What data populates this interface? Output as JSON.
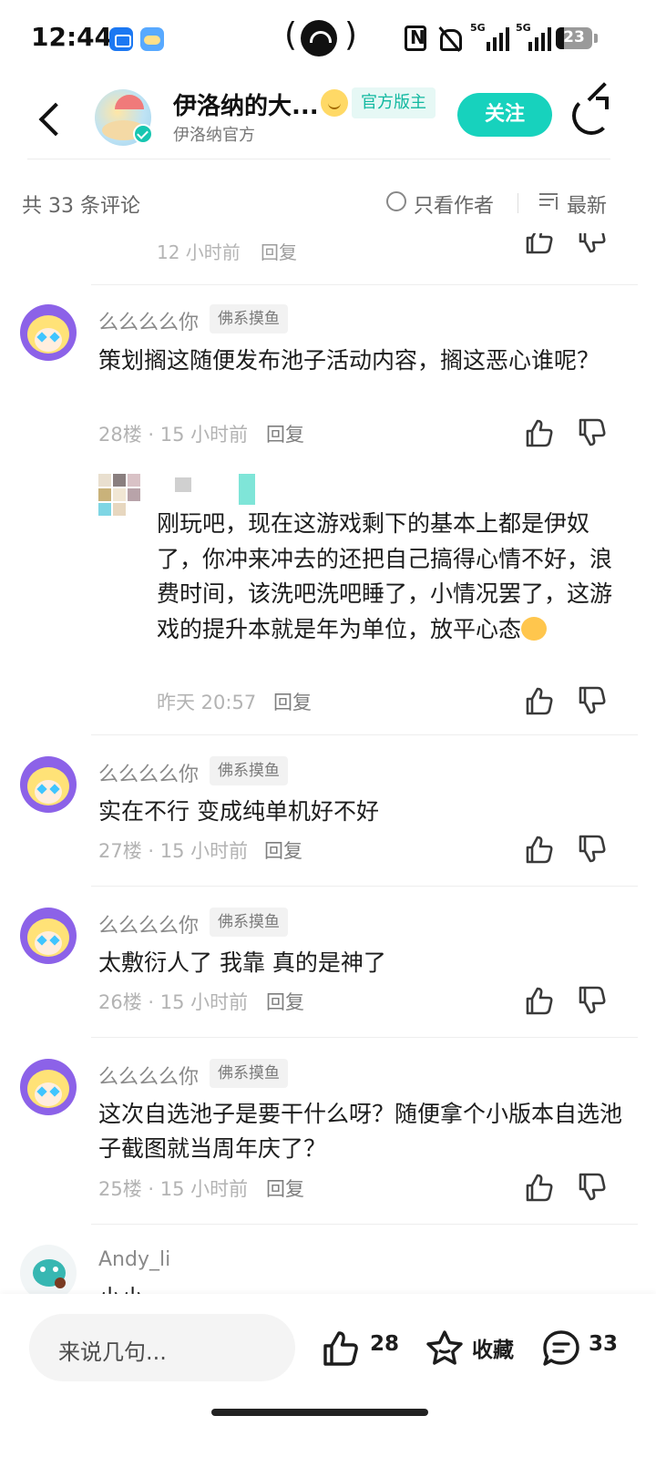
{
  "status_bar": {
    "time": "12:44",
    "signal1_label": "5G",
    "signal2_label": "5G",
    "battery": "23",
    "battery_fraction": 0.23,
    "icons": [
      "app-notification-icon",
      "weather-app-icon",
      "hotspot-icon",
      "nfc-icon",
      "mute-icon",
      "signal-icon",
      "battery-icon"
    ]
  },
  "header": {
    "forum_title": "伊洛纳的大...",
    "official_badge": "官方版主",
    "forum_subtitle": "伊洛纳官方",
    "follow_label": "关注",
    "icons": [
      "back-icon",
      "verified-icon",
      "share-icon"
    ]
  },
  "comments_bar": {
    "count_label": "共 33 条评论",
    "author_only_label": "只看作者",
    "sort_label": "最新"
  },
  "partial_comment": {
    "meta": "12 小时前",
    "reply_label": "回复"
  },
  "comments": [
    {
      "username": "么么么么你",
      "tag": "佛系摸鱼",
      "content": "策划搁这随便发布池子活动内容，搁这恶心谁呢？",
      "meta": "28楼 · 15 小时前",
      "reply_label": "回复",
      "reply": {
        "content": "刚玩吧，现在这游戏剩下的基本上都是伊奴了，你冲来冲去的还把自己搞得心情不好，浪费时间，该洗吧洗吧睡了，小情况罢了，这游戏的提升本就是年为单位，放平心态",
        "meta": "昨天 20:57",
        "reply_label": "回复"
      }
    },
    {
      "username": "么么么么你",
      "tag": "佛系摸鱼",
      "content": "实在不行 变成纯单机好不好",
      "meta": "27楼 · 15 小时前",
      "reply_label": "回复"
    },
    {
      "username": "么么么么你",
      "tag": "佛系摸鱼",
      "content": "太敷衍人了 我靠 真的是神了",
      "meta": "26楼 · 15 小时前",
      "reply_label": "回复"
    },
    {
      "username": "么么么么你",
      "tag": "佛系摸鱼",
      "content": "这次自选池子是要干什么呀？随便拿个小版本自选池子截图就当周年庆了？",
      "meta": "25楼 · 15 小时前",
      "reply_label": "回复"
    },
    {
      "username": "Andy_li",
      "content": "小小"
    }
  ],
  "bottom_bar": {
    "input_placeholder": "来说几句...",
    "like_count": "28",
    "favorite_label": "收藏",
    "comment_count": "33",
    "icons": [
      "like-icon",
      "star-icon",
      "comment-icon"
    ]
  },
  "colors": {
    "accent": "#17d2bd",
    "badge_text": "#11b8a0",
    "badge_bg": "#e6f8f5"
  }
}
